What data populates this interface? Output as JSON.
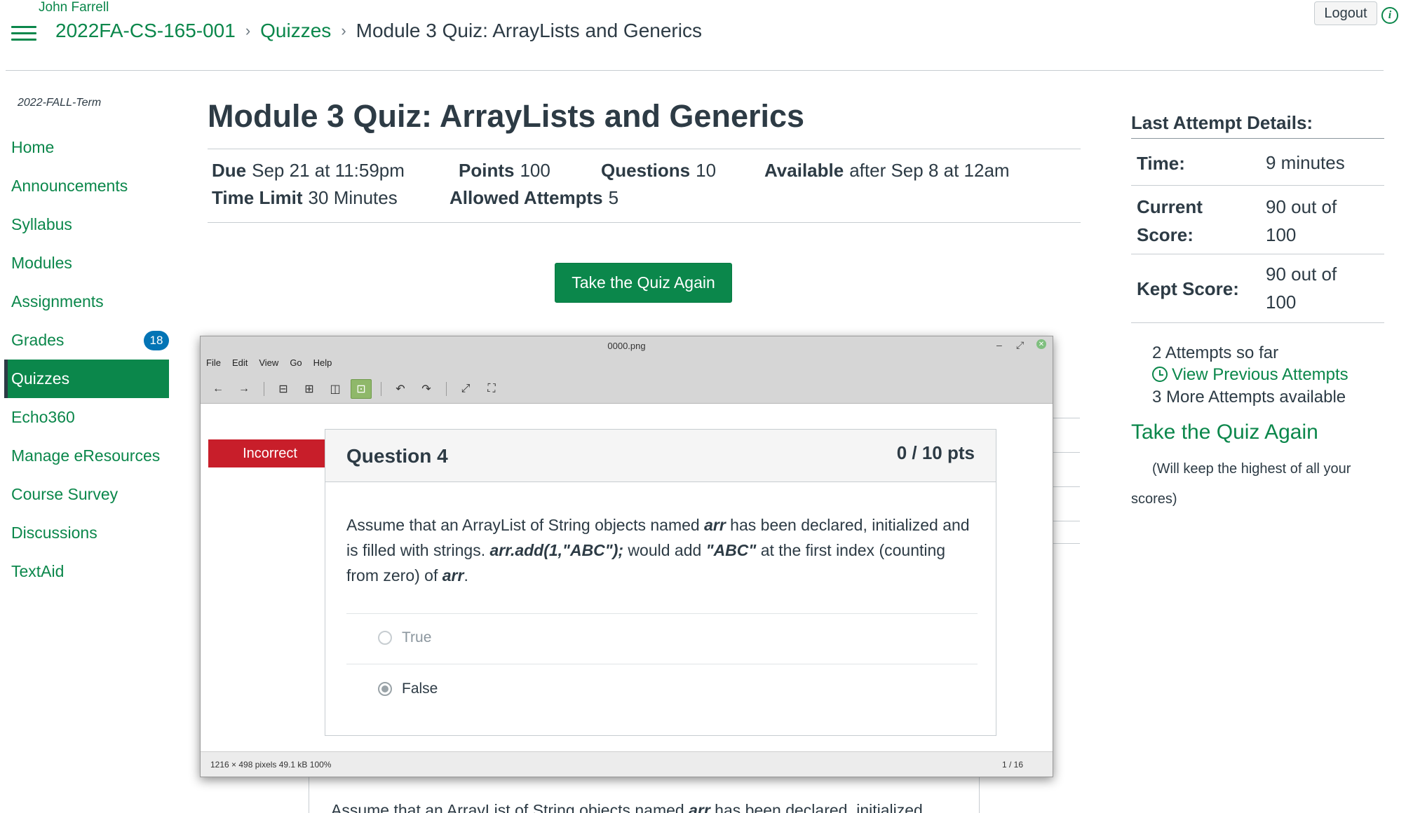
{
  "header": {
    "user_name": "John Farrell",
    "breadcrumb": [
      "2022FA-CS-165-001",
      "Quizzes",
      "Module 3 Quiz: ArrayLists and Generics"
    ],
    "logout_label": "Logout",
    "info_glyph": "i"
  },
  "sidebar": {
    "term": "2022-FALL-Term",
    "items": [
      {
        "label": "Home"
      },
      {
        "label": "Announcements"
      },
      {
        "label": "Syllabus"
      },
      {
        "label": "Modules"
      },
      {
        "label": "Assignments"
      },
      {
        "label": "Grades",
        "badge": "18"
      },
      {
        "label": "Quizzes",
        "active": true
      },
      {
        "label": "Echo360"
      },
      {
        "label": "Manage eResources"
      },
      {
        "label": "Course Survey"
      },
      {
        "label": "Discussions"
      },
      {
        "label": "TextAid"
      }
    ]
  },
  "quiz": {
    "title": "Module 3 Quiz: ArrayLists and Generics",
    "due_label": "Due",
    "due_value": "Sep 21 at 11:59pm",
    "points_label": "Points",
    "points_value": "100",
    "questions_label": "Questions",
    "questions_value": "10",
    "available_label": "Available",
    "available_value": "after Sep 8 at 12am",
    "time_limit_label": "Time Limit",
    "time_limit_value": "30 Minutes",
    "attempts_label": "Allowed Attempts",
    "attempts_value": "5",
    "take_again_button": "Take the Quiz Again"
  },
  "last_attempt": {
    "title": "Last Attempt Details:",
    "time_label": "Time:",
    "time_value": "9 minutes",
    "current_label_1": "Current",
    "current_label_2": "Score:",
    "current_value_1": "90 out of",
    "current_value_2": "100",
    "kept_label": "Kept Score:",
    "kept_value_1": "90 out of",
    "kept_value_2": "100",
    "attempts_so_far": "2 Attempts so far",
    "view_previous": "View Previous Attempts",
    "more_available": "3 More Attempts available",
    "take_again_link": "Take the Quiz Again",
    "keep_note": "(Will keep the highest of all your scores)"
  },
  "viewer": {
    "title": "0000.png",
    "menu": [
      "File",
      "Edit",
      "View",
      "Go",
      "Help"
    ],
    "status_left": "1216 × 498 pixels  49.1 kB   100%",
    "status_right": "1 / 16"
  },
  "question": {
    "status": "Incorrect",
    "name": "Question 4",
    "points": "0 / 10 pts",
    "text_1": "Assume that an ArrayList of String objects named ",
    "text_arr": "arr",
    "text_2": " has been declared, initialized and is filled with strings. ",
    "text_code": "arr.add(1,\"ABC\");",
    "text_3": " would add ",
    "text_abc": "\"ABC\"",
    "text_4": " at the first index (counting from zero) of ",
    "text_arr2": "arr",
    "text_5": ".",
    "answers": [
      {
        "label": "True",
        "selected": false
      },
      {
        "label": "False",
        "selected": true
      }
    ]
  },
  "underlying": {
    "text_1": "Assume that an ArrayList of String objects named ",
    "text_arr": "arr",
    "text_2": " has been declared, initialized"
  }
}
